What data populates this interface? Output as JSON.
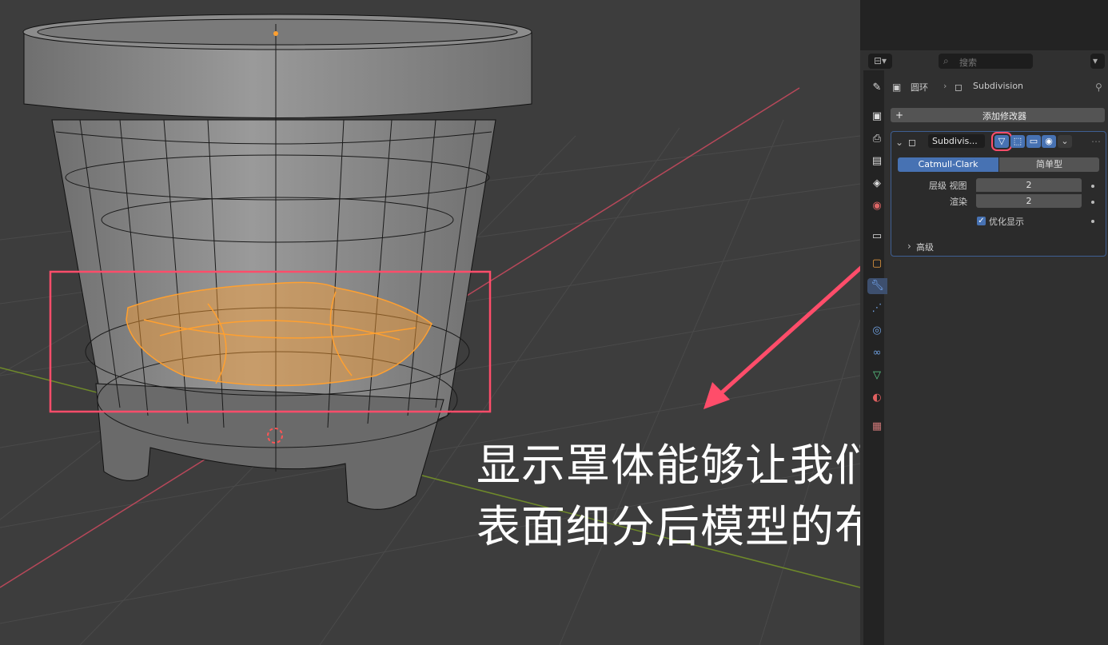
{
  "breadcrumb": {
    "object": "圆环",
    "modifier": "Subdivision"
  },
  "search": {
    "placeholder": "搜索"
  },
  "add_modifier": {
    "label": "添加修改器"
  },
  "modifier": {
    "name": "Subdivis...",
    "types": [
      "Catmull-Clark",
      "简单型"
    ],
    "active_type": "Catmull-Clark",
    "levels_viewport_label": "层级 视图",
    "levels_viewport": "2",
    "render_label": "渲染",
    "render": "2",
    "optimal_display_label": "优化显示",
    "optimal_display_checked": true,
    "advanced_label": "高级"
  },
  "annotation": {
    "line1": "显示罩体能够让我们看见",
    "line2": "表面细分后模型的布线情况",
    "color": "#ff4d6a"
  },
  "colors": {
    "accent": "#4772b3",
    "selection": "#ffa030",
    "highlight": "#ff4d6a"
  },
  "icons": [
    "editor-type-icon",
    "search-icon",
    "tool-icon",
    "render-icon",
    "output-icon",
    "view-layer-icon",
    "scene-icon",
    "world-icon",
    "collection-icon",
    "object-icon",
    "wrench-icon",
    "particles-icon",
    "physics-icon",
    "constraints-icon",
    "data-icon",
    "material-icon",
    "texture-icon",
    "pin-icon",
    "on-cage-icon",
    "edit-mode-icon",
    "realtime-icon",
    "render-toggle-icon",
    "close-icon"
  ]
}
